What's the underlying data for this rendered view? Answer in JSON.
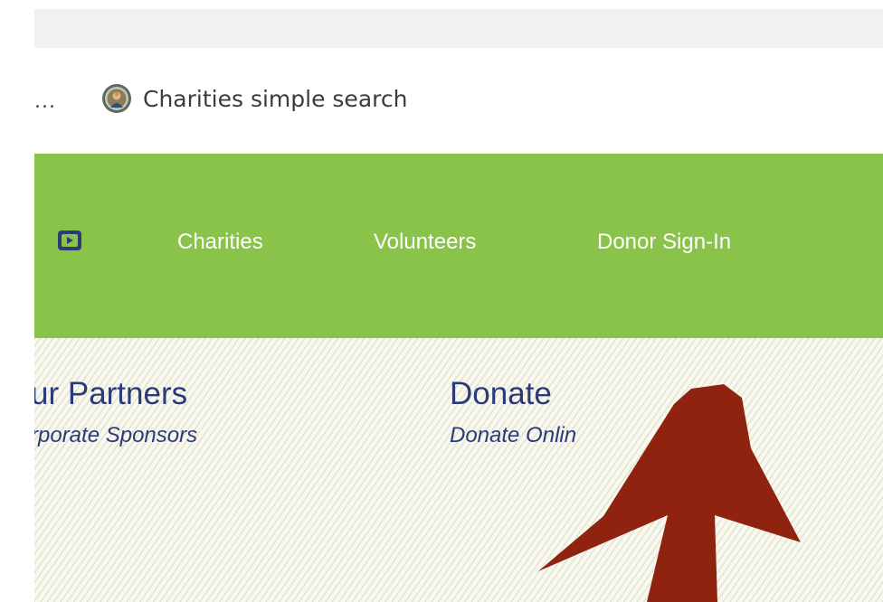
{
  "bookmarks": {
    "overflow": "...",
    "item_label": "Charities simple search"
  },
  "nav": {
    "links": [
      {
        "label": "Charities"
      },
      {
        "label": "Volunteers"
      },
      {
        "label": "Donor Sign-In"
      }
    ]
  },
  "content": {
    "partners": {
      "title": "ur Partners",
      "subtitle": "rporate Sponsors"
    },
    "donate": {
      "title": "Donate",
      "subtitle": "Donate Onlin"
    }
  },
  "colors": {
    "nav_background": "#89c349",
    "link_text": "#2d3a78",
    "arrow": "#8f2310",
    "youtube_icon": "#2d3a78"
  },
  "icons": {
    "favicon": "seal-favicon-icon",
    "youtube": "youtube-icon",
    "annotation": "red-arrow-annotation"
  }
}
